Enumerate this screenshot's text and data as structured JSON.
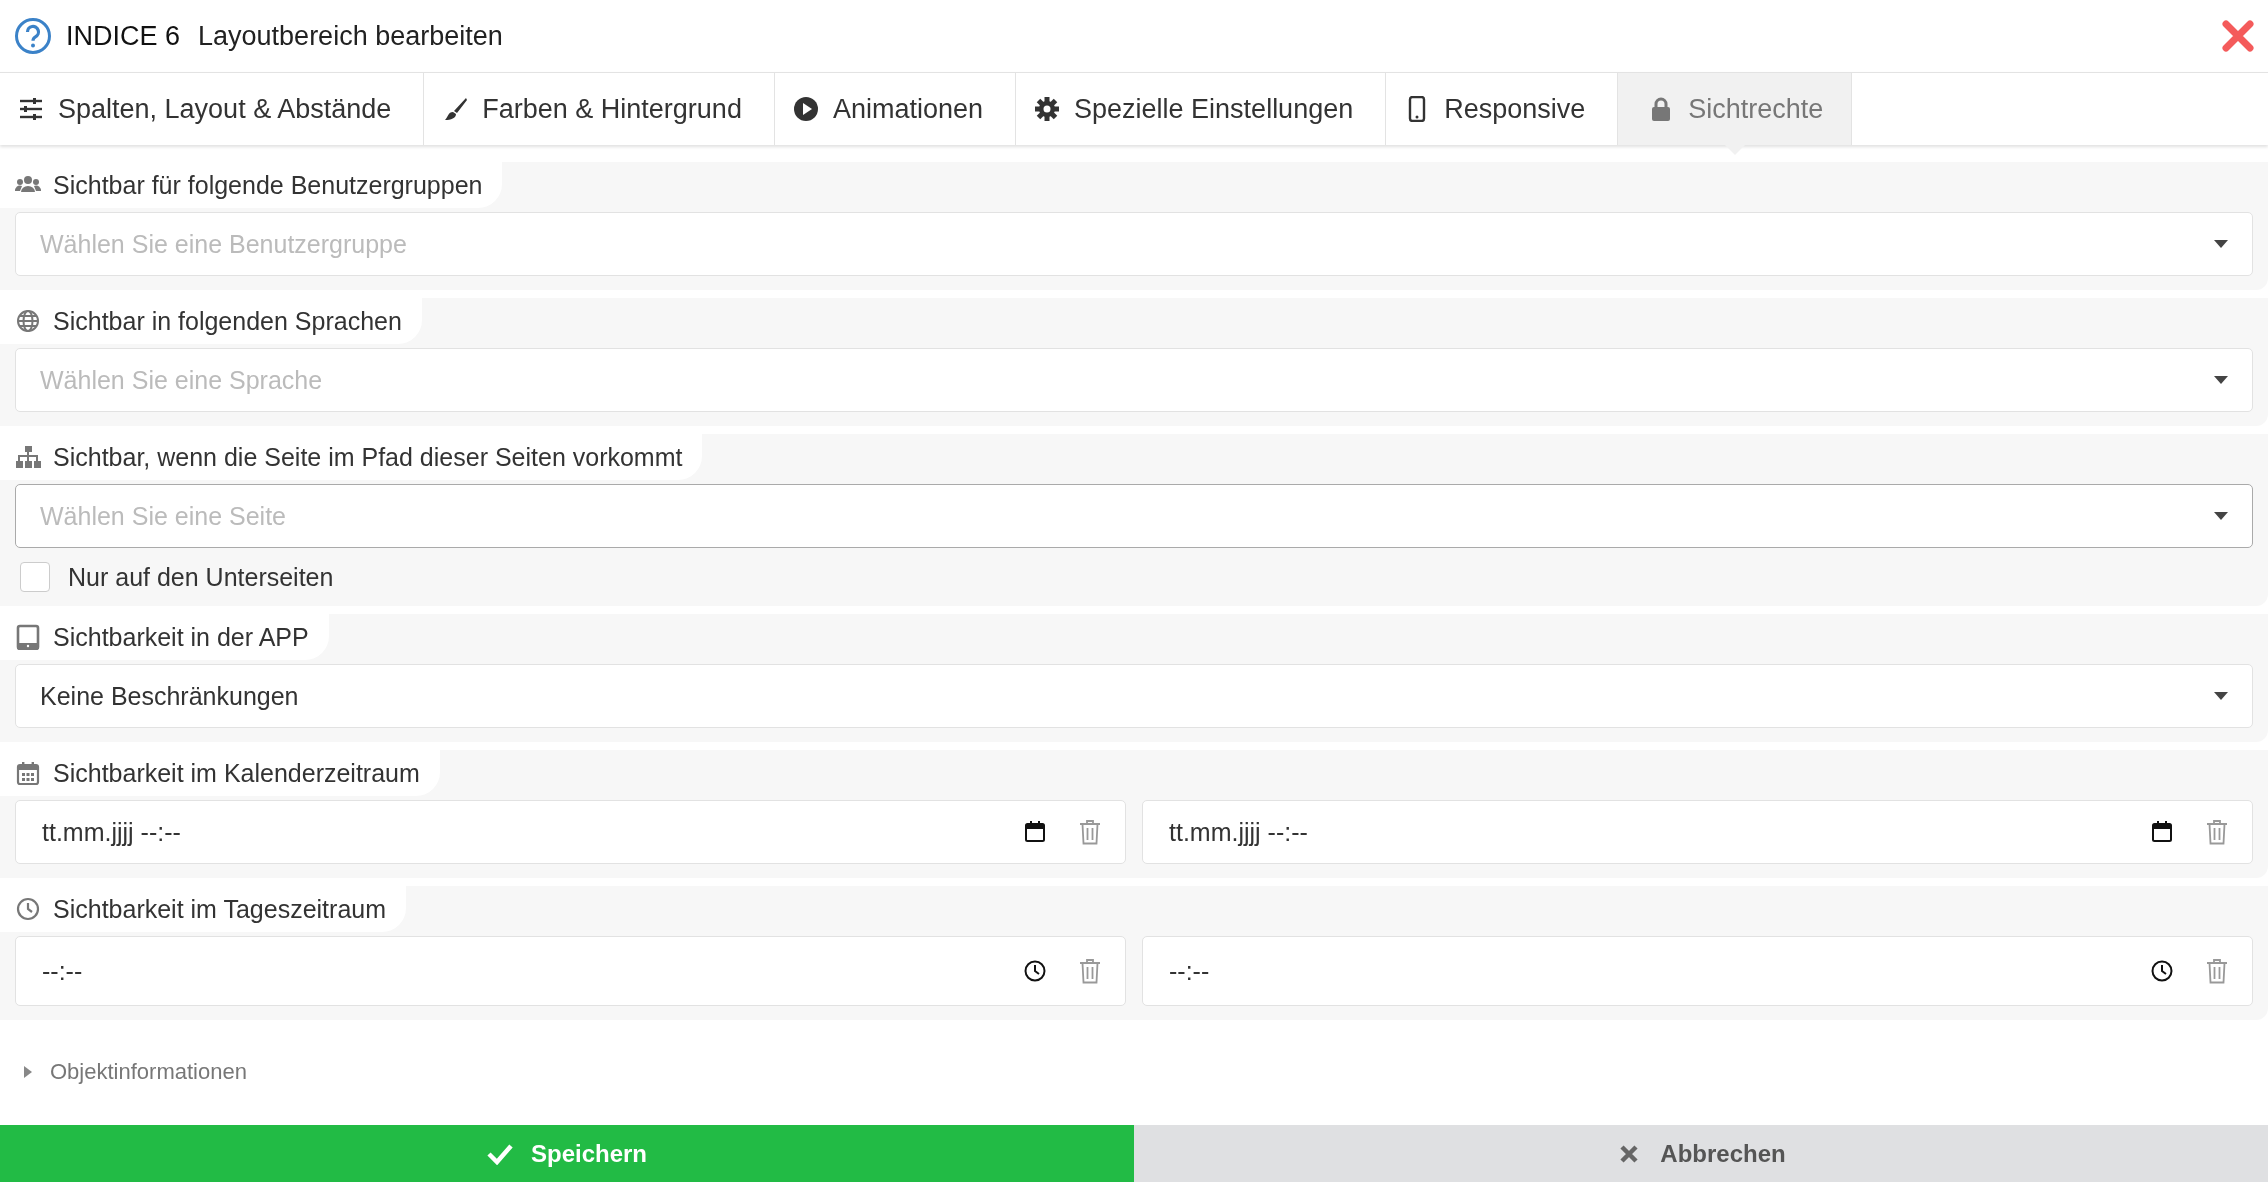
{
  "dialog": {
    "badge": "INDICE 6",
    "title": "Layoutbereich bearbeiten"
  },
  "tabs": [
    {
      "label": "Spalten, Layout & Abstände",
      "selected": false
    },
    {
      "label": "Farben & Hintergrund",
      "selected": false
    },
    {
      "label": "Animationen",
      "selected": false
    },
    {
      "label": "Spezielle Einstellungen",
      "selected": false
    },
    {
      "label": "Responsive",
      "selected": false
    },
    {
      "label": "Sichtrechte",
      "selected": true
    }
  ],
  "sections": [
    {
      "label": "Sichtbar für folgende Benutzergruppen",
      "kind": "select",
      "field": {
        "placeholder": "Wählen Sie eine Benutzergruppe"
      }
    },
    {
      "label": "Sichtbar in folgenden Sprachen",
      "kind": "select",
      "field": {
        "placeholder": "Wählen Sie eine Sprache"
      }
    },
    {
      "label": "Sichtbar, wenn die Seite im Pfad dieser Seiten vorkommt",
      "kind": "select",
      "field": {
        "placeholder": "Wählen Sie eine Seite"
      },
      "checkbox": {
        "label": "Nur auf den Unterseiten",
        "checked": false
      }
    },
    {
      "label": "Sichtbarkeit in der APP",
      "kind": "select",
      "field": {
        "value": "Keine Beschränkungen"
      }
    },
    {
      "label": "Sichtbarkeit im Kalenderzeitraum",
      "kind": "date-range",
      "fields": [
        {
          "value": "tt.mm.jjjj --:--"
        },
        {
          "value": "tt.mm.jjjj --:--"
        }
      ]
    },
    {
      "label": "Sichtbarkeit im Tageszeitraum",
      "kind": "time-range",
      "fields": [
        {
          "value": "--:--"
        },
        {
          "value": "--:--"
        }
      ]
    }
  ],
  "collapsible": {
    "label": "Objektinformationen",
    "expanded": false
  },
  "buttons": [
    {
      "label": "Speichern",
      "kind": "save"
    },
    {
      "label": "Abbrechen",
      "kind": "cancel"
    }
  ]
}
